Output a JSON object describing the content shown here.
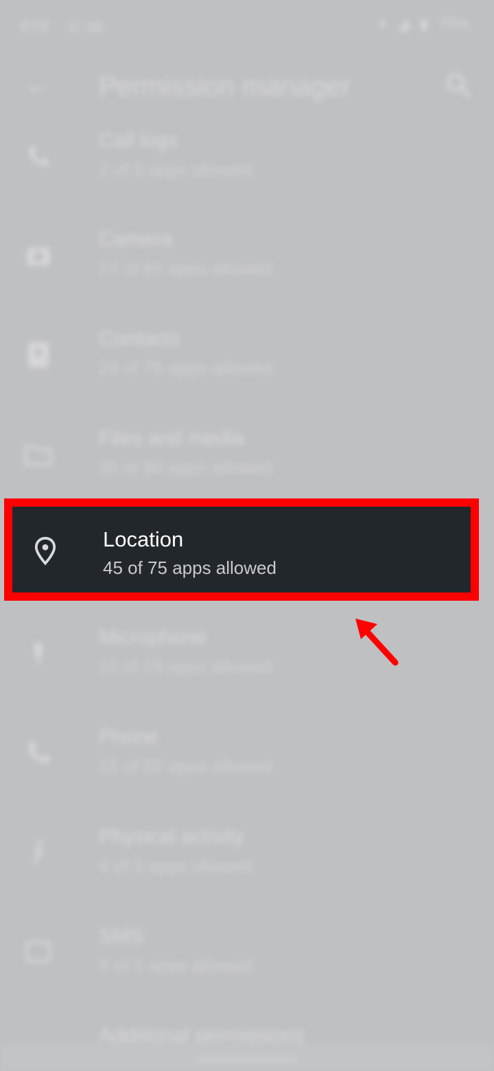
{
  "status_bar": {
    "time": "8:02",
    "left_indicators": "Ⓐ 36",
    "battery": "75%"
  },
  "toolbar": {
    "title": "Permission manager"
  },
  "permissions": [
    {
      "id": "call-logs",
      "title": "Call logs",
      "subtitle": "2 of 5 apps allowed",
      "icon": "call-log-icon"
    },
    {
      "id": "camera",
      "title": "Camera",
      "subtitle": "27 of 65 apps allowed",
      "icon": "camera-icon"
    },
    {
      "id": "contacts",
      "title": "Contacts",
      "subtitle": "24 of 76 apps allowed",
      "icon": "contacts-icon"
    },
    {
      "id": "files-and-media",
      "title": "Files and media",
      "subtitle": "35 of 90 apps allowed",
      "icon": "folder-icon"
    },
    {
      "id": "location",
      "title": "Location",
      "subtitle": "45 of 75 apps allowed",
      "icon": "location-pin-icon"
    },
    {
      "id": "microphone",
      "title": "Microphone",
      "subtitle": "15 of 29 apps allowed",
      "icon": "microphone-icon"
    },
    {
      "id": "phone",
      "title": "Phone",
      "subtitle": "15 of 50 apps allowed",
      "icon": "phone-icon"
    },
    {
      "id": "physical-activity",
      "title": "Physical activity",
      "subtitle": "4 of 5 apps allowed",
      "icon": "activity-icon"
    },
    {
      "id": "sms",
      "title": "SMS",
      "subtitle": "5 of 5 apps allowed",
      "icon": "sms-icon"
    },
    {
      "id": "additional-permissions",
      "title": "Additional permissions",
      "subtitle": "",
      "icon": "more-icon"
    }
  ],
  "highlight": {
    "title": "Location",
    "subtitle": "45 of 75 apps allowed"
  },
  "colors": {
    "highlight_border": "#ff0000",
    "highlight_bg": "#22272c",
    "overlay_bg": "#bfc0c2"
  }
}
